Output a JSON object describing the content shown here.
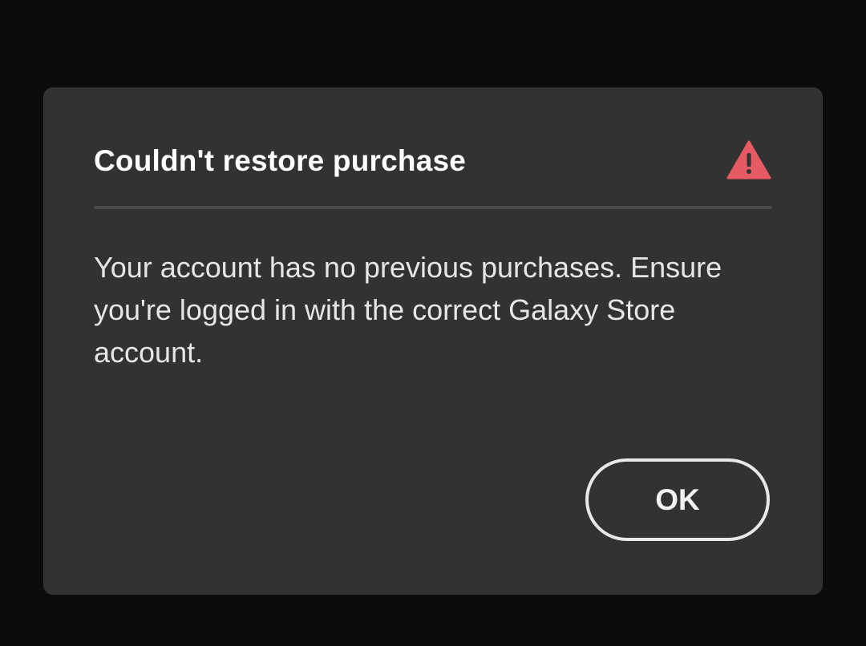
{
  "dialog": {
    "title": "Couldn't restore purchase",
    "icon": "alert-triangle-icon",
    "icon_color": "#e65a63",
    "message": "Your account has no previous purchases. Ensure you're logged in with the correct Galaxy Store account.",
    "ok_label": "OK"
  },
  "colors": {
    "backdrop": "#0b0b0b",
    "dialog_background": "#323232",
    "divider": "#4b4b4b",
    "button_border": "#e8e8e8"
  }
}
